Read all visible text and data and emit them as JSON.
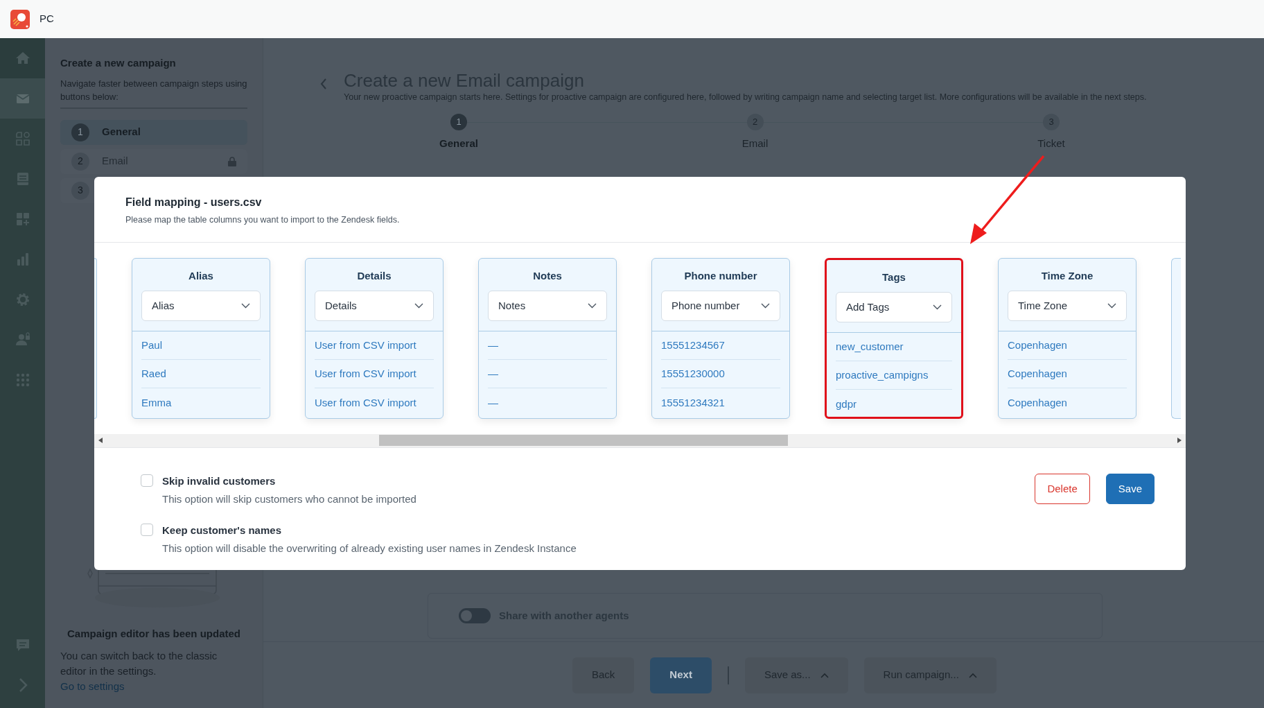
{
  "app": {
    "title": "PC"
  },
  "rail": [
    {
      "selected": false
    },
    {
      "selected": true
    },
    {
      "selected": false
    },
    {
      "selected": false
    },
    {
      "selected": false
    },
    {
      "selected": false
    },
    {
      "selected": false
    },
    {
      "selected": false
    },
    {
      "selected": false
    }
  ],
  "side_panel": {
    "title": "Create a new campaign",
    "subtitle": "Navigate faster between campaign steps using buttons below:",
    "steps": [
      {
        "number": "1",
        "label": "General",
        "selected": true,
        "locked": false
      },
      {
        "number": "2",
        "label": "Email",
        "selected": false,
        "locked": true
      },
      {
        "number": "3",
        "selected": false,
        "locked": false
      }
    ],
    "notice": {
      "title": "Campaign editor has been updated",
      "text": "You can switch back to the classic editor in the settings.",
      "link": "Go to settings"
    }
  },
  "main": {
    "title": "Create a new Email campaign",
    "subtitle": "Your new proactive campaign starts here. Settings for proactive campaign are configured here, followed by writing campaign name and selecting target list. More configurations will be available in the next steps.",
    "stepper": [
      {
        "number": "1",
        "label": "General",
        "selected": true
      },
      {
        "number": "2",
        "label": "Email",
        "selected": false
      },
      {
        "number": "3",
        "label": "Ticket",
        "selected": false
      }
    ],
    "share_toggle": {
      "label": "Share with another agents",
      "on": false
    },
    "footer_buttons": [
      {
        "label": "Back",
        "kind": "secondary",
        "caret": false
      },
      {
        "label": "Next",
        "kind": "primary",
        "caret": false
      },
      {
        "label": "Save as...",
        "kind": "secondary",
        "caret": true
      },
      {
        "label": "Run campaign...",
        "kind": "secondary",
        "caret": true
      }
    ]
  },
  "modal": {
    "title": "Field mapping - users.csv",
    "subtitle": "Please map the table columns you want to import to the Zendesk fields.",
    "columns": [
      {
        "header": "Alias",
        "select": "Alias",
        "highlighted": false,
        "cells": [
          "Paul",
          "Raed",
          "Emma"
        ]
      },
      {
        "header": "Details",
        "select": "Details",
        "highlighted": false,
        "cells": [
          "User from CSV import",
          "User from CSV import",
          "User from CSV import"
        ]
      },
      {
        "header": "Notes",
        "select": "Notes",
        "highlighted": false,
        "cells": [
          "—",
          "—",
          "—"
        ]
      },
      {
        "header": "Phone number",
        "select": "Phone number",
        "highlighted": false,
        "cells": [
          "15551234567",
          "15551230000",
          "15551234321"
        ]
      },
      {
        "header": "Tags",
        "select": "Add Tags",
        "highlighted": true,
        "cells": [
          "new_customer",
          "proactive_campigns",
          "gdpr"
        ]
      },
      {
        "header": "Time Zone",
        "select": "Time Zone",
        "highlighted": false,
        "cells": [
          "Copenhagen",
          "Copenhagen",
          "Copenhagen"
        ]
      }
    ],
    "options": [
      {
        "label": "Skip invalid customers",
        "description": "This option will skip customers who cannot be imported",
        "checked": false
      },
      {
        "label": "Keep customer's names",
        "description": "This option will disable the overwriting of already existing user names in Zendesk Instance",
        "checked": false
      }
    ],
    "buttons": [
      {
        "label": "Delete",
        "kind": "danger"
      },
      {
        "label": "Save",
        "kind": "primary"
      }
    ]
  }
}
